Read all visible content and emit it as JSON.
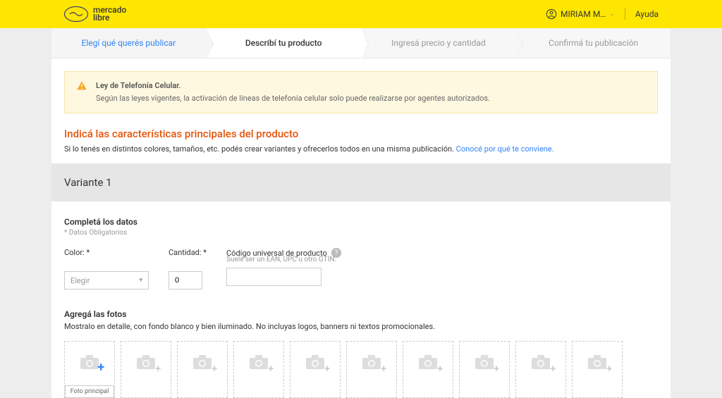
{
  "header": {
    "brand_line1": "mercado",
    "brand_line2": "libre",
    "user_name": "MIRIAM M…",
    "help": "Ayuda"
  },
  "stepper": {
    "step1": "Elegí qué querés publicar",
    "step2": "Describí tu producto",
    "step3": "Ingresá precio y cantidad",
    "step4": "Confirmá tu publicación"
  },
  "alert": {
    "title": "Ley de Telefonía Celular.",
    "body": "Según las leyes vigentes, la activación de líneas de telefonía celular solo puede realizarse por agentes autorizados."
  },
  "section": {
    "title": "Indicá las características principales del producto",
    "desc": "Si lo tenés en distintos colores, tamaños, etc. podés crear variantes y ofrecerlos todos en una misma publicación. ",
    "link": "Conocé por qué te conviene."
  },
  "variant": {
    "title": "Variante 1"
  },
  "form": {
    "complete_title": "Completá los datos",
    "required_note": "* Datos Obligatorios",
    "color_label": "Color: *",
    "color_placeholder": "Elegir",
    "qty_label": "Cantidad: *",
    "qty_value": "0",
    "code_label": "Código universal de producto",
    "code_hint": "Suele ser un EAN, UPC u otro GTIN."
  },
  "photos": {
    "title": "Agregá las fotos",
    "desc": "Mostralo en detalle, con fondo blanco y bien iluminado. No incluyas logos, banners ni textos promocionales.",
    "main_label": "Foto principal"
  }
}
